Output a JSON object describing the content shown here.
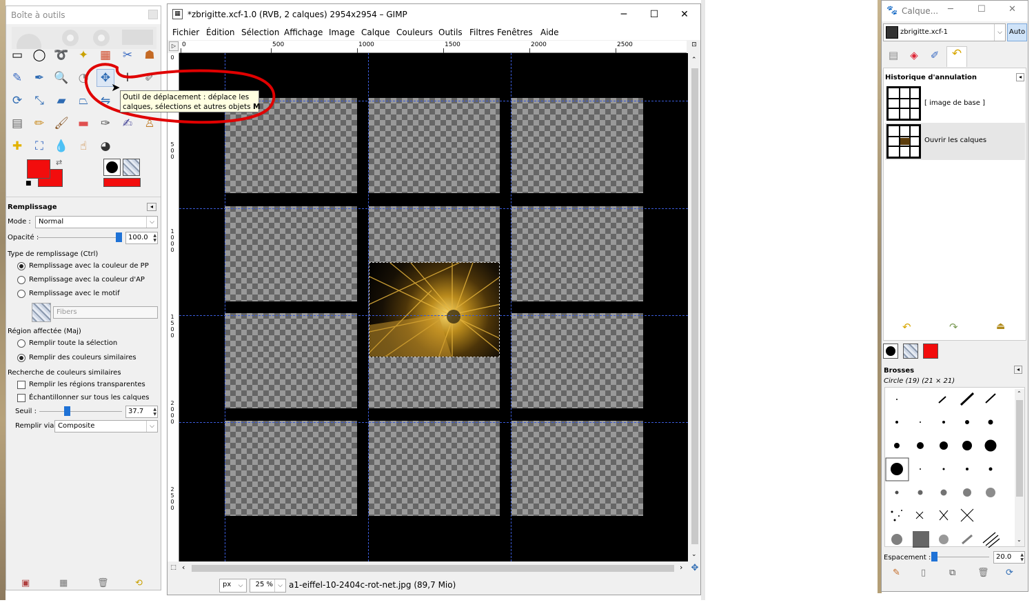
{
  "toolbox": {
    "title": "Boîte à outils",
    "panel_title": "Remplissage",
    "mode_label": "Mode :",
    "mode_value": "Normal",
    "opacity_label": "Opacité :",
    "opacity_value": "100.0",
    "fill_type_label": "Type de remplissage (Ctrl)",
    "fill_fg": "Remplissage avec la couleur de PP",
    "fill_bg": "Remplissage avec la couleur d'AP",
    "fill_pattern": "Remplissage avec le motif",
    "pattern_name": "Fibers",
    "region_label": "Région affectée (Maj)",
    "region_selection": "Remplir toute la sélection",
    "region_similar": "Remplir des couleurs similaires",
    "similar_label": "Recherche de couleurs similaires",
    "fill_transparent": "Remplir les régions transparentes",
    "sample_merged": "Échantillonner sur tous les calques",
    "threshold_label": "Seuil :",
    "threshold_value": "37.7",
    "fill_by_label": "Remplir via :",
    "fill_by_value": "Composite",
    "fg_color": "#f20d0d",
    "bg_color": "#f20d0d"
  },
  "tooltip": {
    "line1": "Outil de déplacement : déplace les",
    "line2": "calques, sélections et autres objets",
    "shortcut": "M"
  },
  "image_window": {
    "title": "*zbrigitte.xcf-1.0 (RVB, 2 calques) 2954x2954 – GIMP",
    "menus": [
      "Fichier",
      "Édition",
      "Sélection",
      "Affichage",
      "Image",
      "Calque",
      "Couleurs",
      "Outils",
      "Filtres",
      "Fenêtres",
      "Aide"
    ],
    "ruler_top": [
      "0",
      "500",
      "1000",
      "1500",
      "2000",
      "2500"
    ],
    "ruler_left": [
      "0",
      "5\n0\n0",
      "1\n0\n0\n0",
      "1\n5\n0\n0",
      "2\n0\n0\n0",
      "2\n5\n0\n0"
    ],
    "unit": "px",
    "zoom": "25 %",
    "status_text": "a1-eiffel-10-2404c-rot-net.jpg (89,7 Mio)"
  },
  "dock": {
    "title": "Calque...",
    "image_name": "zbrigitte.xcf-1",
    "auto_label": "Auto",
    "history_title": "Historique d'annulation",
    "history_items": [
      "[ image de base ]",
      "Ouvrir les calques"
    ],
    "brushes_title": "Brosses",
    "brush_info": "Circle (19) (21 × 21)",
    "spacing_label": "Espacement :",
    "spacing_value": "20.0"
  },
  "colors": {
    "accent": "#1f72d6",
    "annotation": "#e00000",
    "guide": "#3a5bd9"
  }
}
